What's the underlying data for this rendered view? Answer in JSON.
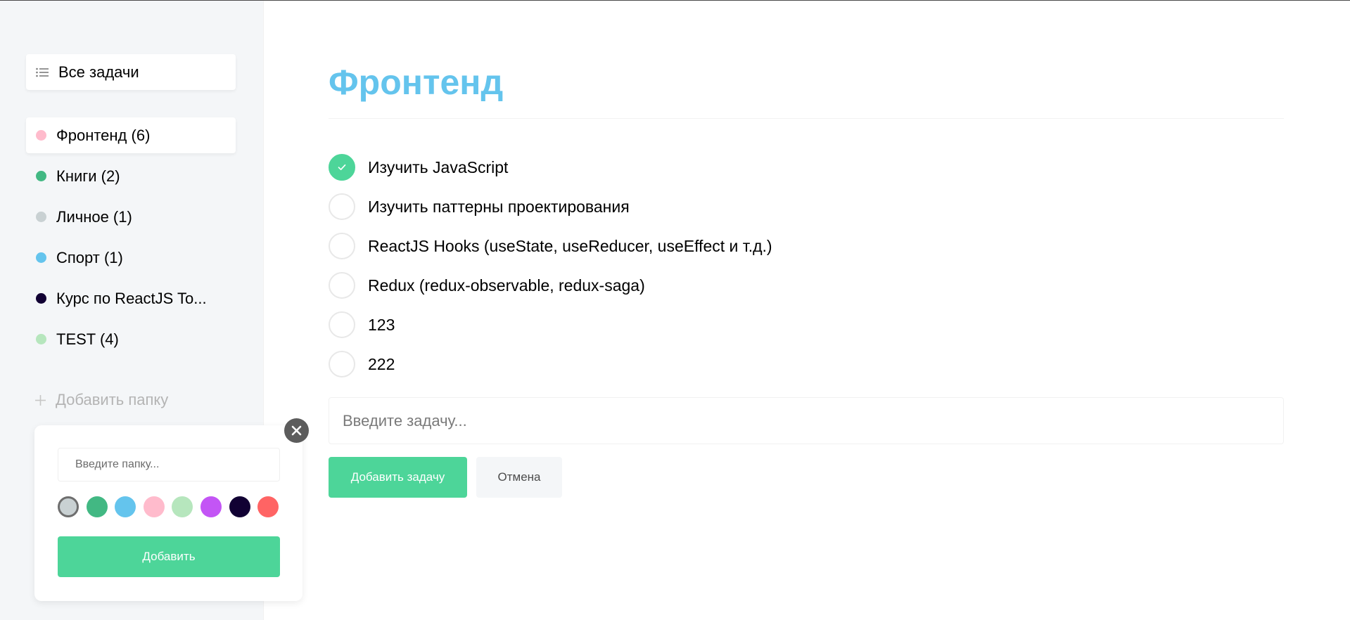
{
  "sidebar": {
    "all_tasks": {
      "label": "Все задачи",
      "icon": "list-icon"
    },
    "folders": [
      {
        "label": "Фронтенд (6)",
        "color": "#ffbbcc",
        "active": true
      },
      {
        "label": "Книги (2)",
        "color": "#42b883",
        "active": false
      },
      {
        "label": "Личное (1)",
        "color": "#c9d1d3",
        "active": false
      },
      {
        "label": "Спорт (1)",
        "color": "#64c4ed",
        "active": false
      },
      {
        "label": "Курс по ReactJS To...",
        "color": "#110133",
        "active": false
      },
      {
        "label": "TEST (4)",
        "color": "#b6e6bd",
        "active": false
      }
    ],
    "add_folder_label": "Добавить папку"
  },
  "popup": {
    "input_placeholder": "Введите папку...",
    "colors": [
      "#c9d1d3",
      "#42b883",
      "#64c4ed",
      "#ffbbcc",
      "#b6e6bd",
      "#c355f5",
      "#110133",
      "#ff6464"
    ],
    "selected_color": "#c9d1d3",
    "add_label": "Добавить"
  },
  "main": {
    "title": "Фронтенд",
    "title_color": "#64c4ed",
    "tasks": [
      {
        "text": "Изучить JavaScript",
        "completed": true
      },
      {
        "text": "Изучить паттерны проектирования",
        "completed": false
      },
      {
        "text": "ReactJS Hooks (useState, useReducer, useEffect и т.д.)",
        "completed": false
      },
      {
        "text": "Redux (redux-observable, redux-saga)",
        "completed": false
      },
      {
        "text": "123",
        "completed": false
      },
      {
        "text": "222",
        "completed": false
      }
    ],
    "task_input_placeholder": "Введите задачу...",
    "add_task_label": "Добавить задачу",
    "cancel_label": "Отмена"
  },
  "colors": {
    "accent": "#4dd599",
    "sidebar_bg": "#f4f6f8"
  }
}
